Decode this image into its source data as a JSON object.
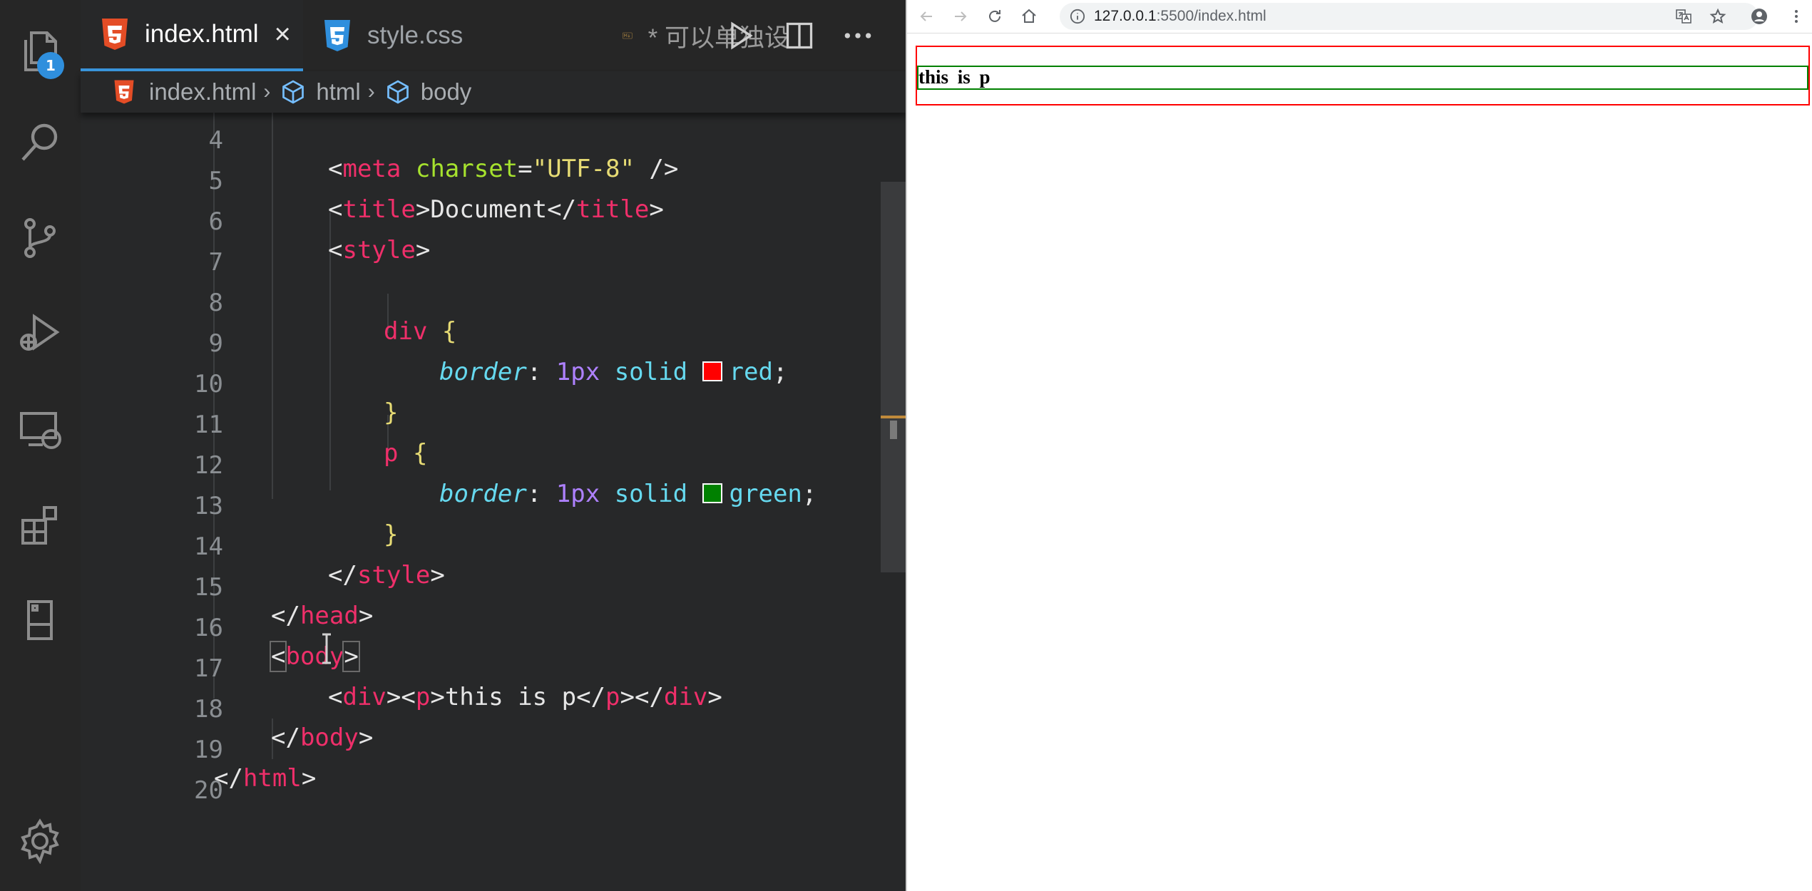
{
  "editor": {
    "activity_bar": {
      "explorer_badge": "1"
    },
    "tabs": [
      {
        "label": "index.html",
        "active": true,
        "close": "×"
      },
      {
        "label": "style.css",
        "active": false
      },
      {
        "label": "* 可以单独设",
        "active": false
      }
    ],
    "breadcrumbs": [
      "index.html",
      "html",
      "body"
    ],
    "code_lines": [
      {
        "num": "4",
        "text": "<meta charset=\"UTF-8\" />"
      },
      {
        "num": "5",
        "text": "<title>Document</title>"
      },
      {
        "num": "6",
        "text": "<style>"
      },
      {
        "num": "7",
        "text": ""
      },
      {
        "num": "8",
        "text": "div {"
      },
      {
        "num": "9",
        "text": "border: 1px solid red;"
      },
      {
        "num": "10",
        "text": "}"
      },
      {
        "num": "11",
        "text": "p {"
      },
      {
        "num": "12",
        "text": "border: 1px solid green;"
      },
      {
        "num": "13",
        "text": "}"
      },
      {
        "num": "14",
        "text": "</style>"
      },
      {
        "num": "15",
        "text": "</head>"
      },
      {
        "num": "16",
        "text": "<body>"
      },
      {
        "num": "17",
        "text": "<div><p>this is p</p></div>"
      },
      {
        "num": "18",
        "text": "</body>"
      },
      {
        "num": "19",
        "text": "</html>"
      },
      {
        "num": "20",
        "text": ""
      }
    ],
    "colors": {
      "tag": "#ef2f6a",
      "attribute": "#a6e22e",
      "string": "#e6db74",
      "property": "#66d9ef",
      "number": "#ae81ff",
      "swatch_red": "#ff0000",
      "swatch_green": "#008000",
      "accent": "#3a96dd"
    }
  },
  "browser": {
    "url_host": "127.0.0.1",
    "url_path": ":5500/index.html",
    "page": {
      "paragraph_text": "this is p",
      "div_border_color": "#ff0000",
      "p_border_color": "#008000"
    }
  }
}
